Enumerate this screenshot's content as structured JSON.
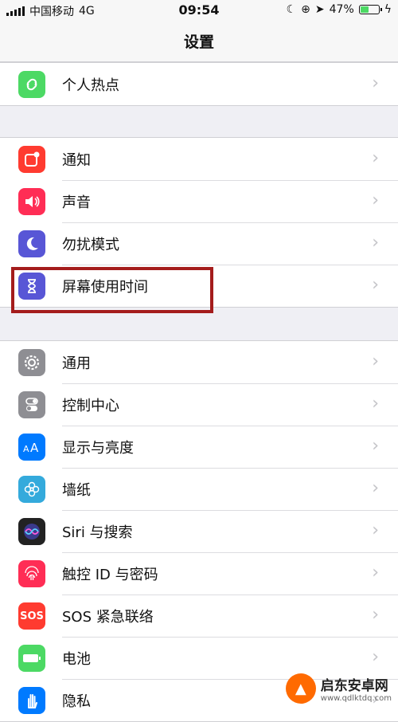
{
  "status": {
    "carrier": "中国移动",
    "network": "4G",
    "time": "09:54",
    "battery": "47%",
    "battery_level": 0.47
  },
  "header": {
    "title": "设置"
  },
  "groups": [
    {
      "items": [
        {
          "label": "个人热点",
          "icon": "hotspot-icon",
          "color": "#4cd964"
        }
      ]
    },
    {
      "items": [
        {
          "label": "通知",
          "icon": "notification-icon",
          "color": "#ff3b30"
        },
        {
          "label": "声音",
          "icon": "speaker-icon",
          "color": "#ff2d55"
        },
        {
          "label": "勿扰模式",
          "icon": "moon-icon",
          "color": "#5856d6"
        },
        {
          "label": "屏幕使用时间",
          "icon": "hourglass-icon",
          "color": "#5856d6"
        }
      ]
    },
    {
      "items": [
        {
          "label": "通用",
          "icon": "gear-icon",
          "color": "#8e8e93"
        },
        {
          "label": "控制中心",
          "icon": "toggles-icon",
          "color": "#8e8e93"
        },
        {
          "label": "显示与亮度",
          "icon": "display-icon",
          "color": "#007aff"
        },
        {
          "label": "墙纸",
          "icon": "flower-icon",
          "color": "#34aadc"
        },
        {
          "label": "Siri 与搜索",
          "icon": "siri-icon",
          "color": "#222222"
        },
        {
          "label": "触控 ID 与密码",
          "icon": "fingerprint-icon",
          "color": "#ff2d55"
        },
        {
          "label": "SOS 紧急联络",
          "icon": "sos-icon",
          "color": "#ff3b30",
          "icon_text": "SOS"
        },
        {
          "label": "电池",
          "icon": "battery-icon",
          "color": "#4cd964"
        },
        {
          "label": "隐私",
          "icon": "hand-icon",
          "color": "#007aff"
        }
      ]
    }
  ],
  "chevron": "›",
  "watermark": {
    "main": "启东安卓网",
    "sub": "www.qdlktdq.com"
  }
}
